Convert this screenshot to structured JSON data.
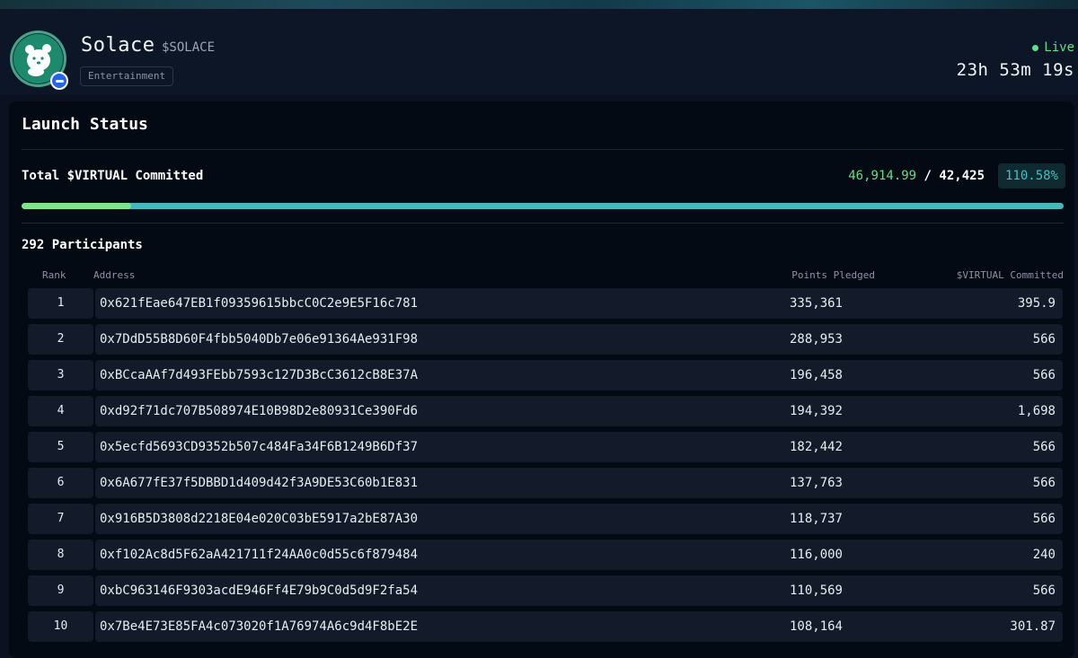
{
  "token": {
    "name": "Solace",
    "ticker": "$SOLACE",
    "category": "Entertainment",
    "status": "Live",
    "countdown": "23h 53m 19s"
  },
  "launch": {
    "title": "Launch Status",
    "committed_label": "Total $VIRTUAL Committed",
    "committed_current": "46,914.99",
    "committed_separator": "/",
    "committed_target": "42,425",
    "percent": "110.58%",
    "progress_fill_fraction": 0.105,
    "participants_label": "292 Participants"
  },
  "table": {
    "headers": {
      "rank": "Rank",
      "address": "Address",
      "points": "Points Pledged",
      "virtual": "$VIRTUAL Committed"
    },
    "rows": [
      {
        "rank": "1",
        "address": "0x621fEae647EB1f09359615bbcC0C2e9E5F16c781",
        "points": "335,361",
        "virtual": "395.9"
      },
      {
        "rank": "2",
        "address": "0x7DdD55B8D60F4fbb5040Db7e06e91364Ae931F98",
        "points": "288,953",
        "virtual": "566"
      },
      {
        "rank": "3",
        "address": "0xBCcaAAf7d493FEbb7593c127D3BcC3612cB8E37A",
        "points": "196,458",
        "virtual": "566"
      },
      {
        "rank": "4",
        "address": "0xd92f71dc707B508974E10B98D2e80931Ce390Fd6",
        "points": "194,392",
        "virtual": "1,698"
      },
      {
        "rank": "5",
        "address": "0x5ecfd5693CD9352b507c484Fa34F6B1249B6Df37",
        "points": "182,442",
        "virtual": "566"
      },
      {
        "rank": "6",
        "address": "0x6A677fE37f5DBBD1d409d42f3A9DE53C60b1E831",
        "points": "137,763",
        "virtual": "566"
      },
      {
        "rank": "7",
        "address": "0x916B5D3808d2218E04e020C03bE5917a2bE87A30",
        "points": "118,737",
        "virtual": "566"
      },
      {
        "rank": "8",
        "address": "0xf102Ac8d5F62aA421711f24AA0c0d55c6f879484",
        "points": "116,000",
        "virtual": "240"
      },
      {
        "rank": "9",
        "address": "0xbC963146F9303acdE946Ff4E79b9C0d5d9F2fa54",
        "points": "110,569",
        "virtual": "566"
      },
      {
        "rank": "10",
        "address": "0x7Be4E73E85FA4c073020f1A76974A6c9d4F8bE2E",
        "points": "108,164",
        "virtual": "301.87"
      }
    ]
  },
  "colors": {
    "accent_green": "#5de08a",
    "accent_teal": "#45b8bb",
    "avatar_bg": "#1e8a6d"
  },
  "icons": {
    "avatar": "bear-mascot-icon",
    "verified": "verified-badge-icon",
    "live": "live-dot-icon"
  }
}
